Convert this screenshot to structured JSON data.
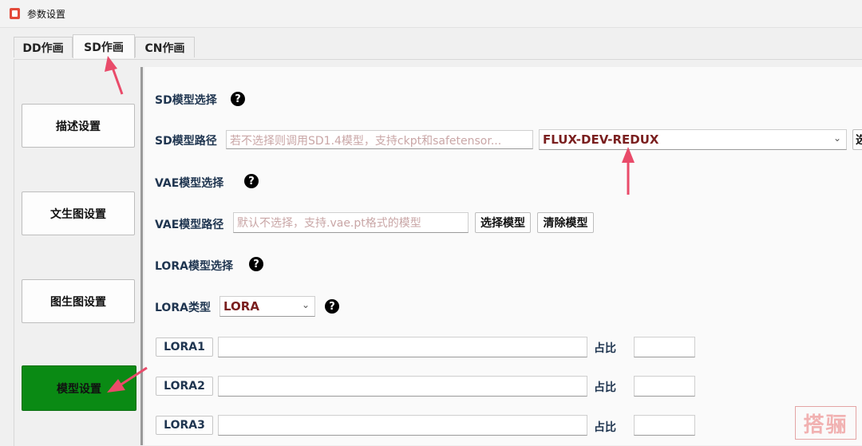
{
  "window": {
    "title": "参数设置"
  },
  "tabs": [
    {
      "label": "DD作画",
      "active": false
    },
    {
      "label": "SD作画",
      "active": true
    },
    {
      "label": "CN作画",
      "active": false
    }
  ],
  "sidebar": {
    "items": [
      {
        "label": "描述设置",
        "active": false
      },
      {
        "label": "文生图设置",
        "active": false
      },
      {
        "label": "图生图设置",
        "active": false
      },
      {
        "label": "模型设置",
        "active": true
      }
    ]
  },
  "sd_section": {
    "title": "SD模型选择",
    "path_label": "SD模型路径",
    "path_placeholder": "若不选择则调用SD1.4模型，支持ckpt和safetensor...",
    "model_value": "FLUX-DEV-REDUX",
    "select_button_partial": "选"
  },
  "vae_section": {
    "title": "VAE模型选择",
    "path_label": "VAE模型路径",
    "path_placeholder": "默认不选择，支持.vae.pt格式的模型",
    "select_button": "选择模型",
    "clear_button": "清除模型"
  },
  "lora_section": {
    "title": "LORA模型选择",
    "type_label": "LORA类型",
    "type_value": "LORA",
    "rows": [
      {
        "label": "LORA1",
        "ratio_label": "占比"
      },
      {
        "label": "LORA2",
        "ratio_label": "占比"
      },
      {
        "label": "LORA3",
        "ratio_label": "占比"
      }
    ]
  },
  "watermark": {
    "text": "搭骊"
  },
  "colors": {
    "active_sidebar": "#0a8a14",
    "combo_text": "#7a1f1f",
    "placeholder": "#c9a6a6",
    "annotation_arrow": "#e94b6a"
  }
}
